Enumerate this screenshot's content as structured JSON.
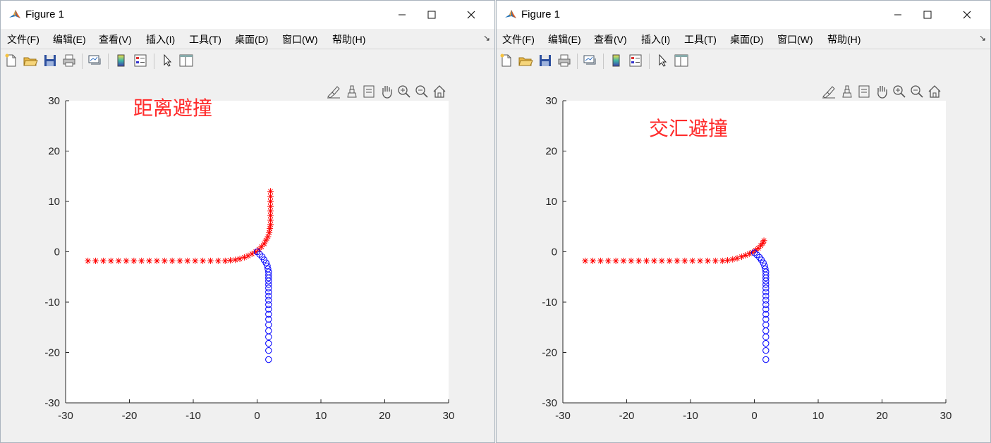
{
  "windows": [
    {
      "title": "Figure 1",
      "menus": [
        "文件(F)",
        "编辑(E)",
        "查看(V)",
        "插入(I)",
        "工具(T)",
        "桌面(D)",
        "窗口(W)",
        "帮助(H)"
      ],
      "menu_more_glyph": "↘",
      "toolbar": [
        "new-figure",
        "open-file",
        "save",
        "print",
        "link-plot",
        "insert-colorbar",
        "insert-legend",
        "edit-plot",
        "property-inspector"
      ],
      "axes_toolbar": [
        "brush",
        "data-tips",
        "zoom-in",
        "pan",
        "zoom-in",
        "zoom-out",
        "restore-view"
      ],
      "plot": {
        "annotation": "距离避撞",
        "annotation_color": "#ff2a2a",
        "chart_data": {
          "type": "scatter",
          "xlim": [
            -30,
            30
          ],
          "ylim": [
            -30,
            30
          ],
          "x_ticks": [
            -30,
            -20,
            -10,
            0,
            10,
            20,
            30
          ],
          "y_ticks": [
            -30,
            -20,
            -10,
            0,
            10,
            20,
            30
          ],
          "tick_labels_x": [
            "-30",
            "-20",
            "-10",
            "0",
            "10",
            "20",
            "30"
          ],
          "tick_labels_y": [
            "-30",
            "-20",
            "-10",
            "0",
            "10",
            "20",
            "30"
          ],
          "grid": false,
          "series": [
            {
              "marker": "star",
              "color": "#ff0000",
              "points": [
                [
                  -26.5,
                  -1.8
                ],
                [
                  -25.3,
                  -1.8
                ],
                [
                  -24.1,
                  -1.8
                ],
                [
                  -22.9,
                  -1.8
                ],
                [
                  -21.7,
                  -1.8
                ],
                [
                  -20.5,
                  -1.8
                ],
                [
                  -19.3,
                  -1.8
                ],
                [
                  -18.1,
                  -1.8
                ],
                [
                  -16.9,
                  -1.8
                ],
                [
                  -15.7,
                  -1.8
                ],
                [
                  -14.5,
                  -1.8
                ],
                [
                  -13.3,
                  -1.8
                ],
                [
                  -12.1,
                  -1.8
                ],
                [
                  -10.9,
                  -1.8
                ],
                [
                  -9.7,
                  -1.8
                ],
                [
                  -8.5,
                  -1.8
                ],
                [
                  -7.3,
                  -1.8
                ],
                [
                  -6.1,
                  -1.8
                ],
                [
                  -5.0,
                  -1.8
                ],
                [
                  -4.2,
                  -1.7
                ],
                [
                  -3.4,
                  -1.6
                ],
                [
                  -2.7,
                  -1.4
                ],
                [
                  -2.0,
                  -1.1
                ],
                [
                  -1.4,
                  -0.8
                ],
                [
                  -0.8,
                  -0.4
                ],
                [
                  -0.2,
                  0.0
                ],
                [
                  0.3,
                  0.5
                ],
                [
                  0.7,
                  1.0
                ],
                [
                  1.1,
                  1.6
                ],
                [
                  1.4,
                  2.3
                ],
                [
                  1.7,
                  3.0
                ],
                [
                  1.9,
                  3.8
                ],
                [
                  2.0,
                  4.6
                ],
                [
                  2.1,
                  5.4
                ],
                [
                  2.1,
                  6.3
                ],
                [
                  2.1,
                  7.2
                ],
                [
                  2.1,
                  8.1
                ],
                [
                  2.1,
                  9.0
                ],
                [
                  2.1,
                  10.0
                ],
                [
                  2.1,
                  11.0
                ],
                [
                  2.1,
                  12.0
                ]
              ]
            },
            {
              "marker": "circle",
              "color": "#0000ff",
              "points": [
                [
                  0.0,
                  0.0
                ],
                [
                  0.4,
                  -0.5
                ],
                [
                  0.8,
                  -1.0
                ],
                [
                  1.1,
                  -1.6
                ],
                [
                  1.4,
                  -2.2
                ],
                [
                  1.6,
                  -2.8
                ],
                [
                  1.7,
                  -3.4
                ],
                [
                  1.8,
                  -4.0
                ],
                [
                  1.8,
                  -4.6
                ],
                [
                  1.8,
                  -5.2
                ],
                [
                  1.8,
                  -5.8
                ],
                [
                  1.8,
                  -6.5
                ],
                [
                  1.8,
                  -7.2
                ],
                [
                  1.8,
                  -8.0
                ],
                [
                  1.8,
                  -8.8
                ],
                [
                  1.8,
                  -9.6
                ],
                [
                  1.8,
                  -10.5
                ],
                [
                  1.8,
                  -11.4
                ],
                [
                  1.8,
                  -12.4
                ],
                [
                  1.8,
                  -13.4
                ],
                [
                  1.8,
                  -14.5
                ],
                [
                  1.8,
                  -15.7
                ],
                [
                  1.8,
                  -16.9
                ],
                [
                  1.8,
                  -18.2
                ],
                [
                  1.8,
                  -19.6
                ],
                [
                  1.8,
                  -21.4
                ]
              ]
            }
          ]
        }
      }
    },
    {
      "title": "Figure 1",
      "menus": [
        "文件(F)",
        "编辑(E)",
        "查看(V)",
        "插入(I)",
        "工具(T)",
        "桌面(D)",
        "窗口(W)",
        "帮助(H)"
      ],
      "menu_more_glyph": "↘",
      "toolbar": [
        "new-figure",
        "open-file",
        "save",
        "print",
        "link-plot",
        "insert-colorbar",
        "insert-legend",
        "edit-plot",
        "property-inspector"
      ],
      "axes_toolbar": [
        "brush",
        "data-tips",
        "zoom-in",
        "pan",
        "zoom-in",
        "zoom-out",
        "restore-view"
      ],
      "plot": {
        "annotation": "交汇避撞",
        "annotation_color": "#ff2a2a",
        "chart_data": {
          "type": "scatter",
          "xlim": [
            -30,
            30
          ],
          "ylim": [
            -30,
            30
          ],
          "x_ticks": [
            -30,
            -20,
            -10,
            0,
            10,
            20,
            30
          ],
          "y_ticks": [
            -30,
            -20,
            -10,
            0,
            10,
            20,
            30
          ],
          "tick_labels_x": [
            "-30",
            "-20",
            "-10",
            "0",
            "10",
            "20",
            "30"
          ],
          "tick_labels_y": [
            "-30",
            "-20",
            "-10",
            "0",
            "10",
            "20",
            "30"
          ],
          "grid": false,
          "series": [
            {
              "marker": "star",
              "color": "#ff0000",
              "points": [
                [
                  -26.5,
                  -1.8
                ],
                [
                  -25.3,
                  -1.8
                ],
                [
                  -24.1,
                  -1.8
                ],
                [
                  -22.9,
                  -1.8
                ],
                [
                  -21.7,
                  -1.8
                ],
                [
                  -20.5,
                  -1.8
                ],
                [
                  -19.3,
                  -1.8
                ],
                [
                  -18.1,
                  -1.8
                ],
                [
                  -16.9,
                  -1.8
                ],
                [
                  -15.7,
                  -1.8
                ],
                [
                  -14.5,
                  -1.8
                ],
                [
                  -13.3,
                  -1.8
                ],
                [
                  -12.1,
                  -1.8
                ],
                [
                  -10.9,
                  -1.8
                ],
                [
                  -9.7,
                  -1.8
                ],
                [
                  -8.5,
                  -1.8
                ],
                [
                  -7.3,
                  -1.8
                ],
                [
                  -6.1,
                  -1.8
                ],
                [
                  -5.0,
                  -1.8
                ],
                [
                  -4.2,
                  -1.7
                ],
                [
                  -3.4,
                  -1.5
                ],
                [
                  -2.7,
                  -1.3
                ],
                [
                  -2.0,
                  -1.0
                ],
                [
                  -1.4,
                  -0.7
                ],
                [
                  -0.8,
                  -0.4
                ],
                [
                  -0.3,
                  -0.1
                ],
                [
                  0.2,
                  0.3
                ],
                [
                  0.6,
                  0.7
                ],
                [
                  1.0,
                  1.2
                ],
                [
                  1.3,
                  1.7
                ],
                [
                  1.5,
                  2.2
                ]
              ]
            },
            {
              "marker": "circle",
              "color": "#0000ff",
              "points": [
                [
                  0.0,
                  -0.2
                ],
                [
                  0.4,
                  -0.6
                ],
                [
                  0.8,
                  -1.1
                ],
                [
                  1.1,
                  -1.6
                ],
                [
                  1.4,
                  -2.2
                ],
                [
                  1.6,
                  -2.8
                ],
                [
                  1.7,
                  -3.4
                ],
                [
                  1.8,
                  -4.0
                ],
                [
                  1.8,
                  -4.6
                ],
                [
                  1.8,
                  -5.2
                ],
                [
                  1.8,
                  -5.8
                ],
                [
                  1.8,
                  -6.5
                ],
                [
                  1.8,
                  -7.2
                ],
                [
                  1.8,
                  -8.0
                ],
                [
                  1.8,
                  -8.8
                ],
                [
                  1.8,
                  -9.6
                ],
                [
                  1.8,
                  -10.5
                ],
                [
                  1.8,
                  -11.4
                ],
                [
                  1.8,
                  -12.4
                ],
                [
                  1.8,
                  -13.4
                ],
                [
                  1.8,
                  -14.5
                ],
                [
                  1.8,
                  -15.7
                ],
                [
                  1.8,
                  -16.9
                ],
                [
                  1.8,
                  -18.2
                ],
                [
                  1.8,
                  -19.6
                ],
                [
                  1.8,
                  -21.4
                ]
              ]
            }
          ]
        }
      }
    }
  ]
}
